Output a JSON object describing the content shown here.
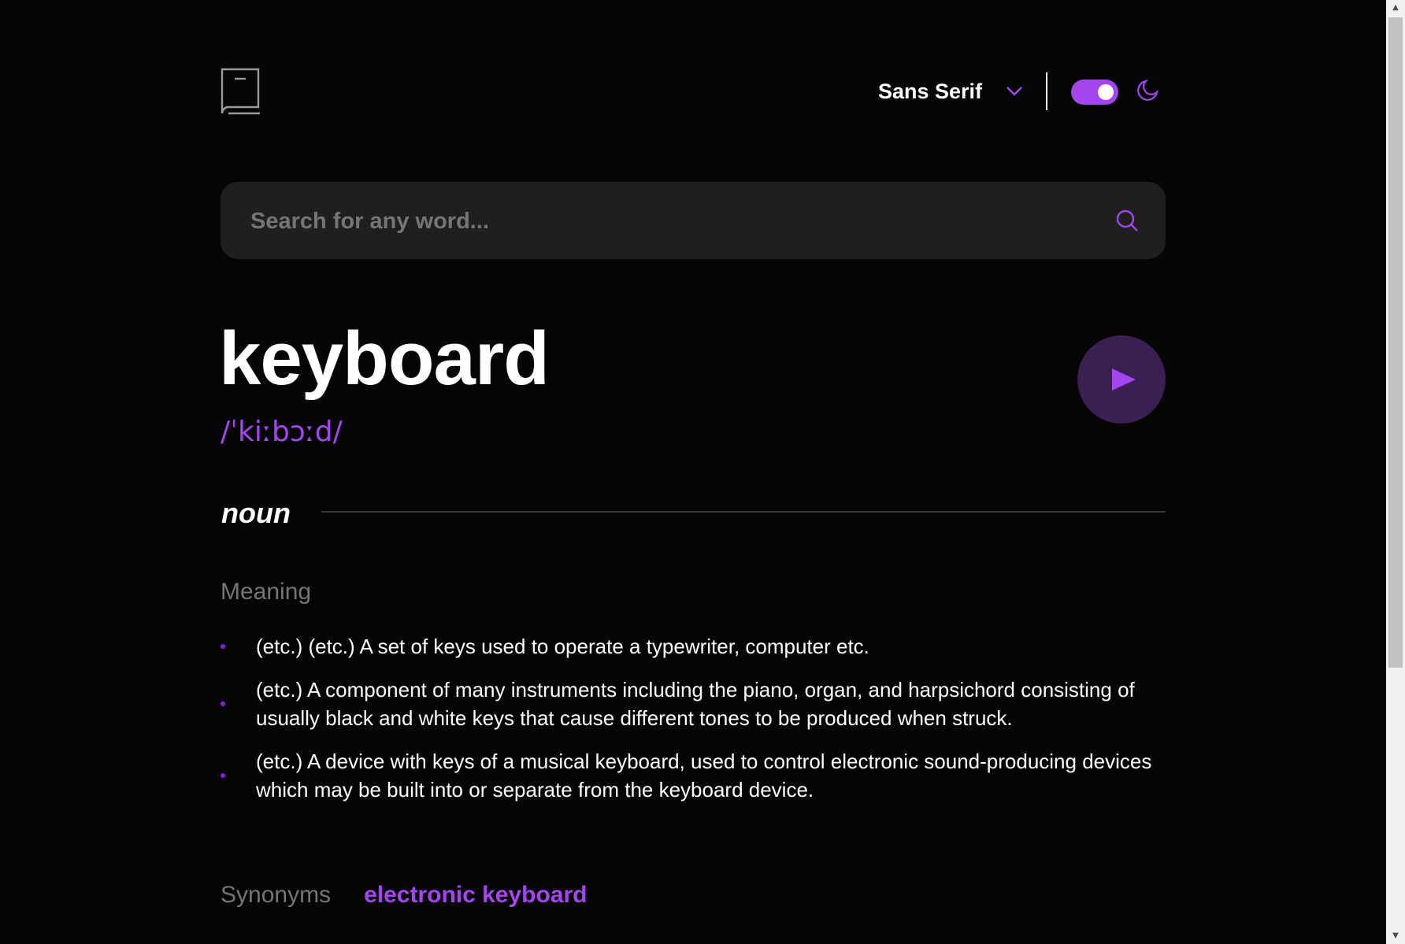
{
  "header": {
    "font_label": "Sans Serif",
    "theme": "dark"
  },
  "search": {
    "placeholder": "Search for any word...",
    "value": ""
  },
  "entry": {
    "word": "keyboard",
    "phonetic": "/ˈkiːbɔːd/",
    "part_of_speech": "noun",
    "meaning_title": "Meaning",
    "definitions": [
      "(etc.) (etc.) A set of keys used to operate a typewriter, computer etc.",
      "(etc.) A component of many instruments including the piano, organ, and harpsichord consisting of usually black and white keys that cause different tones to be produced when struck.",
      "(etc.) A device with keys of a musical keyboard, used to control electronic sound-producing devices which may be built into or separate from the keyboard device."
    ],
    "synonyms_title": "Synonyms",
    "synonyms": [
      "electronic keyboard"
    ]
  },
  "colors": {
    "accent": "#a445ed",
    "background": "#050505",
    "search_bg": "#1f1f1f",
    "muted": "#757575"
  },
  "icons": {
    "logo": "book-icon",
    "dropdown": "chevron-down-icon",
    "theme": "moon-icon",
    "search": "search-icon",
    "play": "play-icon"
  }
}
